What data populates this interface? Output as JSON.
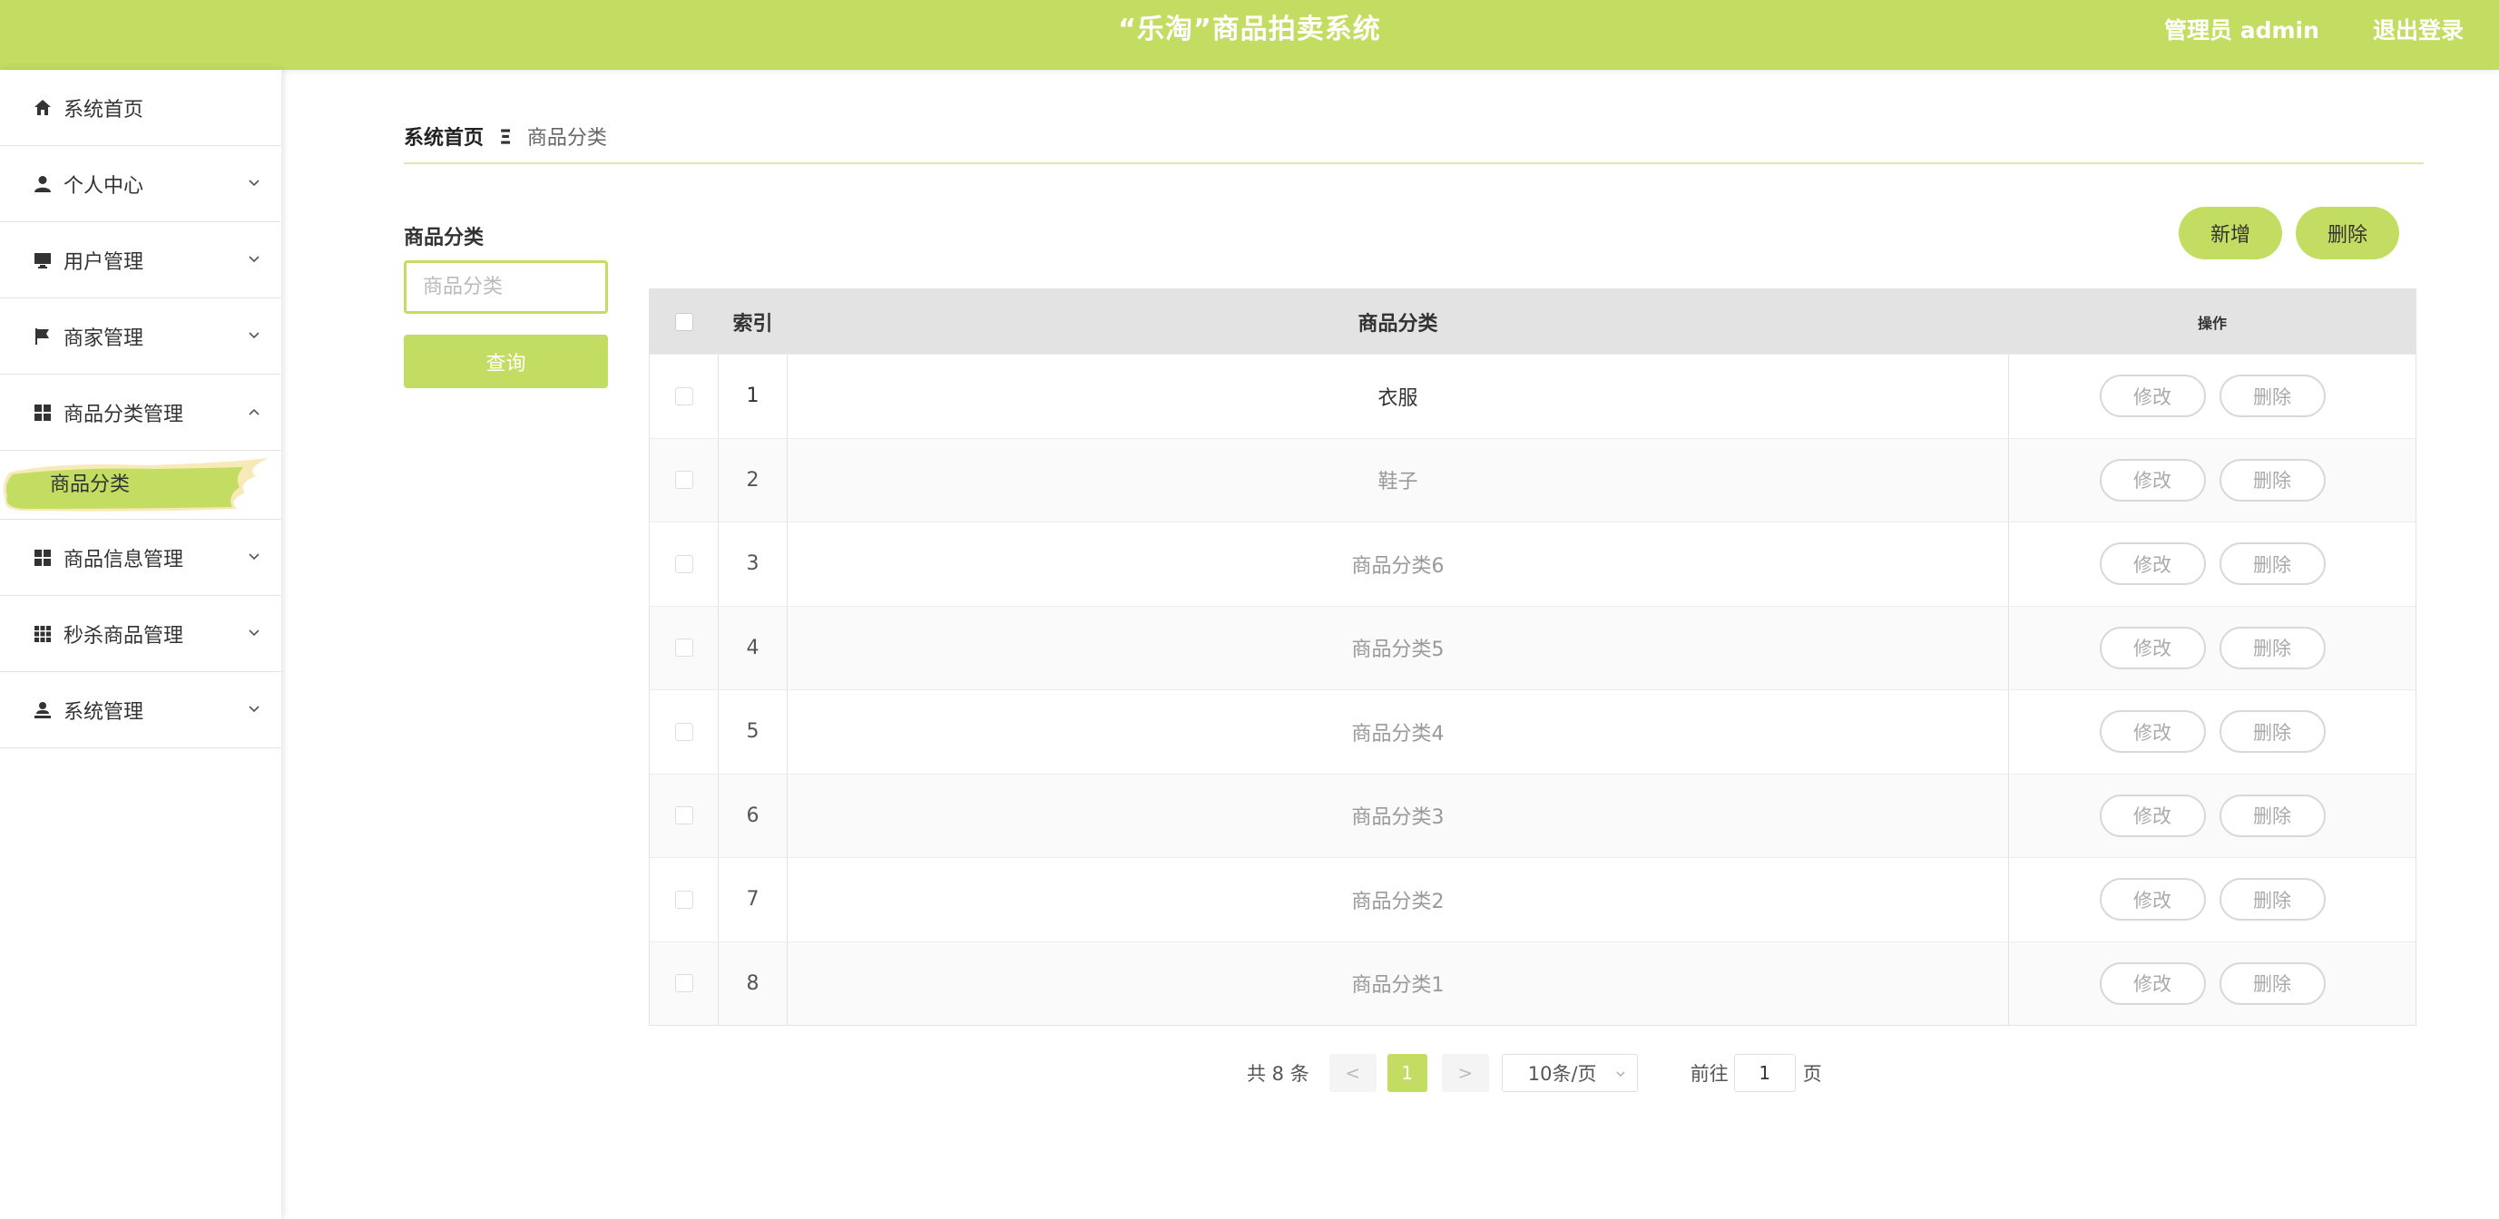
{
  "header": {
    "title": "“乐淘”商品拍卖系统",
    "admin_label": "管理员 admin",
    "logout_label": "退出登录"
  },
  "sidebar": {
    "items": [
      {
        "label": "系统首页",
        "icon": "home-icon"
      },
      {
        "label": "个人中心",
        "icon": "person-icon"
      },
      {
        "label": "用户管理",
        "icon": "monitor-icon"
      },
      {
        "label": "商家管理",
        "icon": "flag-icon"
      },
      {
        "label": "商品分类管理",
        "icon": "grid-icon"
      },
      {
        "label": "商品信息管理",
        "icon": "grid-icon"
      },
      {
        "label": "秒杀商品管理",
        "icon": "apps-icon"
      },
      {
        "label": "系统管理",
        "icon": "user-stamp-icon"
      }
    ],
    "active_sub": "商品分类"
  },
  "breadcrumb": {
    "home": "系统首页",
    "current": "商品分类"
  },
  "search": {
    "label": "商品分类",
    "placeholder": "商品分类",
    "button": "查询"
  },
  "toolbar": {
    "add": "新增",
    "delete": "删除"
  },
  "table": {
    "headers": {
      "index": "索引",
      "name": "商品分类",
      "ops": "操作"
    },
    "rows": [
      {
        "index": "1",
        "name": "衣服"
      },
      {
        "index": "2",
        "name": "鞋子"
      },
      {
        "index": "3",
        "name": "商品分类6"
      },
      {
        "index": "4",
        "name": "商品分类5"
      },
      {
        "index": "5",
        "name": "商品分类4"
      },
      {
        "index": "6",
        "name": "商品分类3"
      },
      {
        "index": "7",
        "name": "商品分类2"
      },
      {
        "index": "8",
        "name": "商品分类1"
      }
    ],
    "edit_label": "修改",
    "delete_label": "删除"
  },
  "pagination": {
    "total": "共 8 条",
    "prev": "<",
    "next": ">",
    "current_page": "1",
    "page_size": "10条/页",
    "goto_label": "前往",
    "goto_value": "1",
    "page_suffix": "页"
  },
  "colors": {
    "accent": "#c3dd62"
  }
}
